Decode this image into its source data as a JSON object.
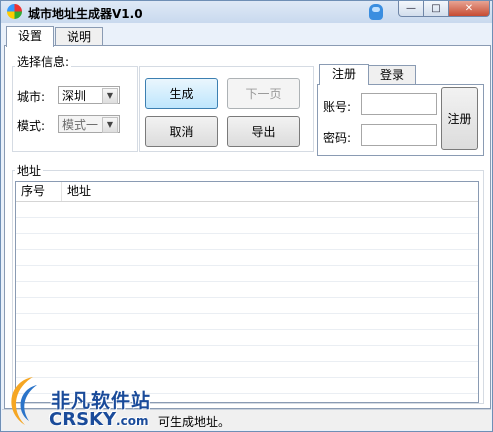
{
  "window": {
    "title": "城市地址生成器V1.0",
    "min_label": "—",
    "max_label": "□",
    "close_label": "✕"
  },
  "main_tabs": [
    {
      "label": "设置"
    },
    {
      "label": "说明"
    }
  ],
  "select_group": {
    "title": "选择信息:",
    "city_label": "城市:",
    "city_value": "深圳",
    "mode_label": "模式:",
    "mode_value": "模式一"
  },
  "buttons": {
    "generate": "生成",
    "next_page": "下一页",
    "cancel": "取消",
    "export": "导出"
  },
  "account_tabs": [
    {
      "label": "注册"
    },
    {
      "label": "登录"
    }
  ],
  "account": {
    "username_label": "账号:",
    "password_label": "密码:",
    "register_button": "注册"
  },
  "address_group": {
    "title": "地址",
    "columns": [
      "序号",
      "地址"
    ]
  },
  "status": {
    "text": "可生成地址。"
  },
  "watermark": {
    "name": "非凡软件站",
    "domain": "CRSKY",
    "domain_suffix": ".com"
  },
  "colors": {
    "title_bar": "#c9d9ee",
    "close_button": "#c64b32",
    "focus_button": "#bee6fd"
  }
}
